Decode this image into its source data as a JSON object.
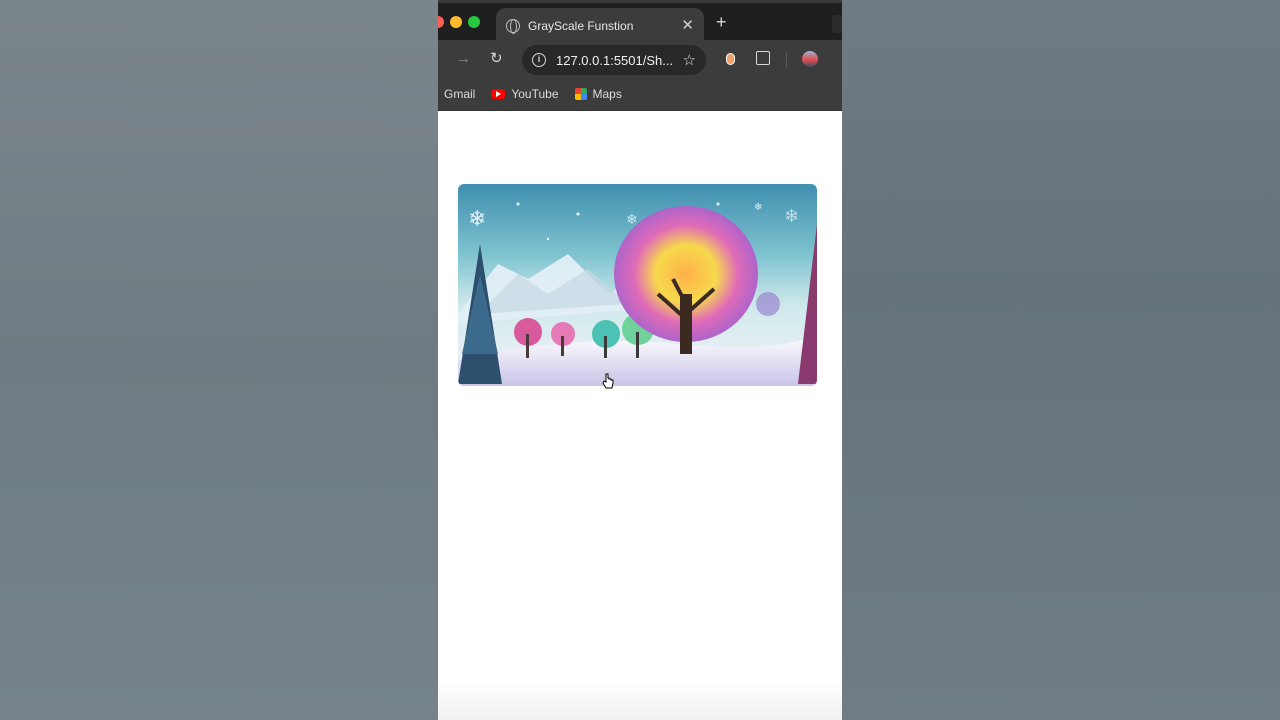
{
  "browser": {
    "tab_title": "GrayScale Funstion",
    "tab_close": "✕",
    "new_tab": "+",
    "url": "127.0.0.1:5501/Sh...",
    "menu": "⋮"
  },
  "bookmarks": [
    {
      "label": "Gmail",
      "icon": "gmail-icon"
    },
    {
      "label": "YouTube",
      "icon": "youtube-icon"
    },
    {
      "label": "Maps",
      "icon": "maps-icon"
    }
  ],
  "page": {
    "image_alt": "",
    "image_subject": "winter landscape with rainbow-colored tree"
  },
  "colors": {
    "chrome_dark": "#1f1f1f",
    "chrome_toolbar": "#3c3c3c",
    "page_bg": "#ffffff"
  }
}
